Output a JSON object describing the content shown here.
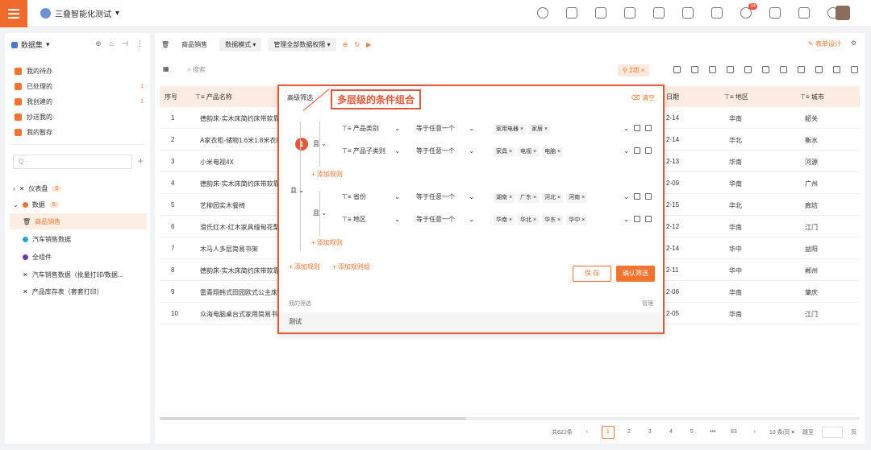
{
  "app": {
    "title": "三叠智能化测试"
  },
  "top_icons": [
    "search-icon",
    "home-icon",
    "grid-icon",
    "apps-icon",
    "layout-icon",
    "card-icon",
    "clipboard-icon",
    "bell-icon",
    "shirt-icon",
    "download-icon",
    "settings-icon"
  ],
  "notifications": "34",
  "sidebar": {
    "header": "数据集",
    "items": [
      {
        "label": "我的待办",
        "count": ""
      },
      {
        "label": "已处理的",
        "count": "1"
      },
      {
        "label": "我创建的",
        "count": "1"
      },
      {
        "label": "抄送我的",
        "count": ""
      },
      {
        "label": "我的暂存",
        "count": ""
      }
    ],
    "search_placeholder": "Q -",
    "tree": [
      {
        "label": "仪表盘",
        "count": "5"
      },
      {
        "label": "数据",
        "count": "5"
      },
      {
        "label": "商品销售",
        "count": ""
      },
      {
        "label": "汽车销售数据",
        "count": ""
      },
      {
        "label": "全组件",
        "count": ""
      },
      {
        "label": "汽车销售数据（批量打印/数据...",
        "count": ""
      },
      {
        "label": "产品库存表（套套打印）",
        "count": ""
      }
    ]
  },
  "breadcrumb": {
    "page": "商品销售",
    "mode": "数据模式",
    "permission": "管理全部数据权限",
    "design": "表单设计"
  },
  "toolbar": {
    "search": "搜索",
    "filter_count": "2项"
  },
  "table": {
    "headers": [
      "序号",
      "产品名称",
      "日期",
      "地区",
      "城市"
    ],
    "rows": [
      {
        "idx": "1",
        "name": "德韵床-实木床简约床带软靠",
        "date": "2-14",
        "region": "华南",
        "city": "韶关"
      },
      {
        "idx": "2",
        "name": "A家衣柜-储物1.6米1.8米衣柜",
        "date": "2-14",
        "region": "华北",
        "city": "衡水"
      },
      {
        "idx": "3",
        "name": "小米电视4X",
        "date": "2-13",
        "region": "华南",
        "city": "河源"
      },
      {
        "idx": "4",
        "name": "德韵床-实木床简约床带软靠",
        "date": "2-09",
        "region": "华南",
        "city": "广州"
      },
      {
        "idx": "5",
        "name": "艺柳园实木餐椅",
        "date": "2-15",
        "region": "华北",
        "city": "廊坊"
      },
      {
        "idx": "6",
        "name": "滑氏红木-红木家具缅甸花梨",
        "date": "2-12",
        "region": "华南",
        "city": "江门"
      },
      {
        "idx": "7",
        "name": "木马人多层简易书架",
        "date": "2-14",
        "region": "华中",
        "city": "益阳"
      },
      {
        "idx": "8",
        "name": "德韵床-实木床简约床带软靠",
        "date": "2-11",
        "region": "华中",
        "city": "郴州"
      },
      {
        "idx": "9",
        "name": "雷青翔韩式田园欧式公主床",
        "date": "2-06",
        "region": "华南",
        "city": "肇庆"
      },
      {
        "idx": "10",
        "name": "众海电脑桌台式家用简易书",
        "date": "2-05",
        "region": "华南",
        "city": "江门"
      }
    ]
  },
  "pager": {
    "total": "共622条",
    "pages": [
      "1",
      "2",
      "3",
      "4",
      "5",
      "•••",
      "83"
    ],
    "page_size": "10 条/页",
    "goto": "跳至",
    "page_unit": "页"
  },
  "filter_modal": {
    "title": "高级筛选",
    "clear": "清空",
    "callout": "多层级的条件组合",
    "marker": "1",
    "and_label": "且",
    "group1": [
      {
        "field": "产品类别",
        "op": "等于任意一个",
        "values": [
          "家用电器",
          "家居"
        ]
      },
      {
        "field": "产品子类别",
        "op": "等于任意一个",
        "values": [
          "家具",
          "电视",
          "电脑"
        ]
      }
    ],
    "group2": [
      {
        "field": "省份",
        "op": "等于任意一个",
        "values": [
          "湖南",
          "广东",
          "河北",
          "河南"
        ]
      },
      {
        "field": "地区",
        "op": "等于任意一个",
        "values": [
          "华南",
          "华北",
          "华东",
          "华中"
        ]
      }
    ],
    "add_rule": "添加规则",
    "add_group": "添加规则组",
    "save": "保 存",
    "confirm": "确认筛选",
    "my_filters": "我的筛选",
    "manage": "管理",
    "saved": [
      "测试"
    ]
  },
  "colors": {
    "accent": "#f0742e",
    "callout": "#e0573a",
    "header_bg": "#fdece1"
  }
}
